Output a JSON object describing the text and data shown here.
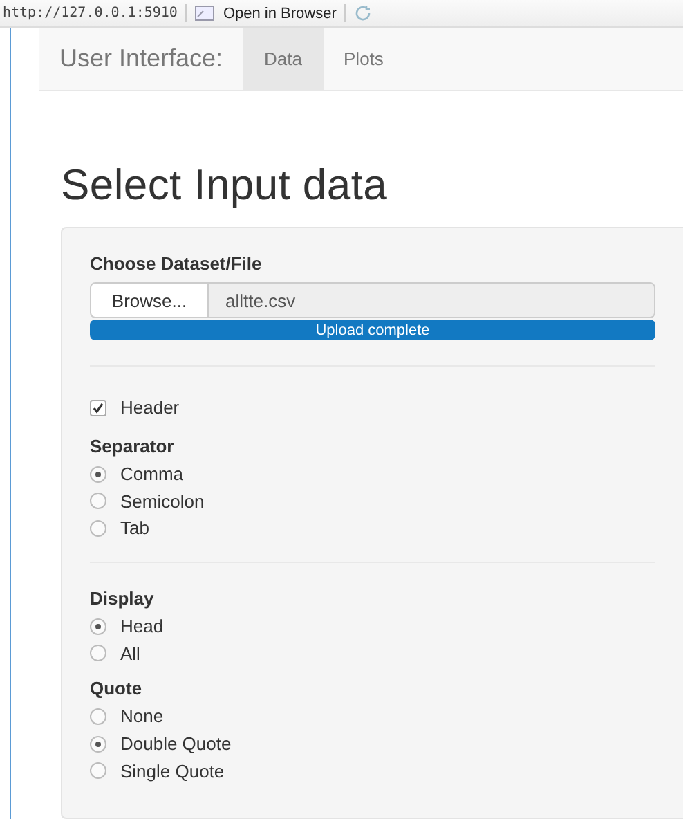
{
  "address_bar": {
    "url": "http://127.0.0.1:5910",
    "open_label": "Open in Browser"
  },
  "navbar": {
    "brand": "User Interface:",
    "tabs": [
      {
        "label": "Data",
        "selected": true
      },
      {
        "label": "Plots",
        "selected": false
      }
    ]
  },
  "title": "Select Input data",
  "file_input": {
    "label": "Choose Dataset/File",
    "button": "Browse...",
    "value": "alltte.csv",
    "progress": {
      "level": 1,
      "text": "Upload complete"
    }
  },
  "header": {
    "label": "Header",
    "checked": true
  },
  "groups": [
    {
      "label": "Separator",
      "options": [
        {
          "label": "Comma",
          "selected": true
        },
        {
          "label": "Semicolon",
          "selected": false
        },
        {
          "label": "Tab",
          "selected": false
        }
      ]
    },
    {
      "label": "Display",
      "options": [
        {
          "label": "Head",
          "selected": true
        },
        {
          "label": "All",
          "selected": false
        }
      ]
    },
    {
      "label": "Quote",
      "options": [
        {
          "label": "None",
          "selected": false
        },
        {
          "label": "Double Quote",
          "selected": true
        },
        {
          "label": "Single Quote",
          "selected": false
        }
      ]
    }
  ]
}
